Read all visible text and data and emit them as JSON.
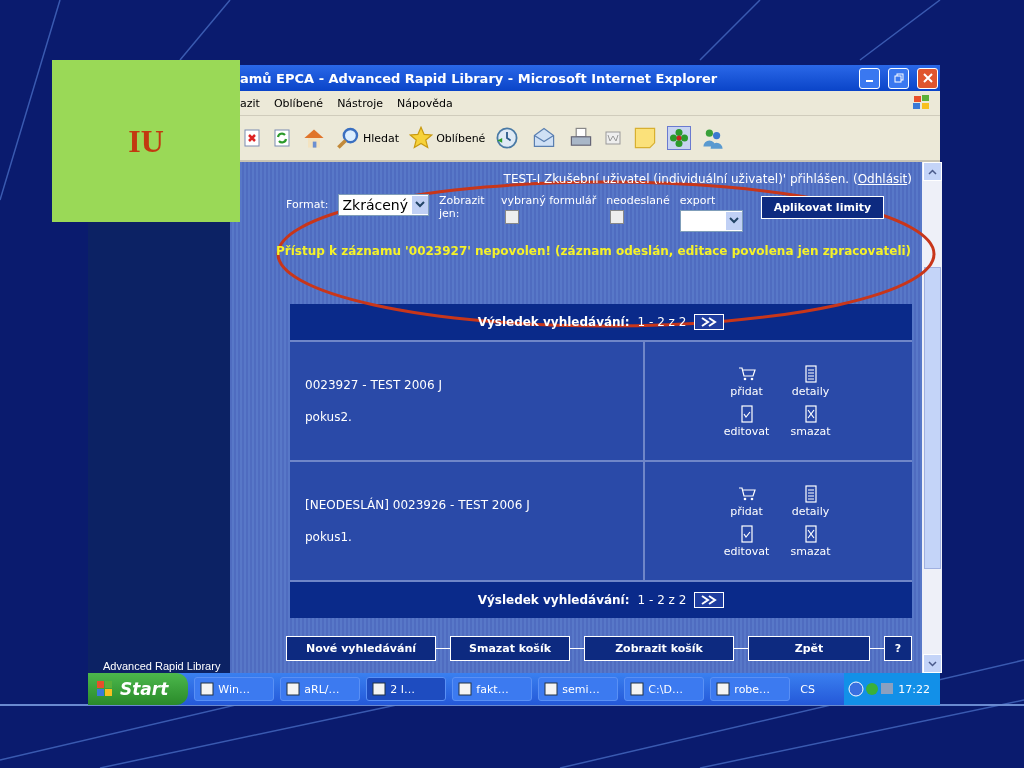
{
  "slide": {
    "label": "IU"
  },
  "window": {
    "title": "amů EPCA - Advanced Rapid Library - Microsoft Internet Explorer"
  },
  "menu": [
    "azit",
    "Oblíbené",
    "Nástroje",
    "Nápověda"
  ],
  "toolbar": [
    {
      "kind": "stop"
    },
    {
      "kind": "refresh"
    },
    {
      "kind": "home"
    },
    {
      "kind": "search",
      "label": "Hledat"
    },
    {
      "kind": "favorites",
      "label": "Oblíbené"
    },
    {
      "kind": "history"
    },
    {
      "kind": "mail"
    },
    {
      "kind": "print"
    },
    {
      "kind": "word"
    },
    {
      "kind": "note"
    },
    {
      "kind": "flower"
    },
    {
      "kind": "people"
    }
  ],
  "page": {
    "user_text": "TEST-I Zkušební uživatel (individuální uživatel)' přihlášen. (",
    "logout_link": "Odhlásit",
    "user_text_end": ")",
    "format_label": "Format:",
    "format_value": "Zkrácený",
    "show_label": "Zobrazit jen:",
    "checkboxes": [
      {
        "label": "vybraný formulář",
        "checked": false
      },
      {
        "label": "neodeslané",
        "checked": false
      }
    ],
    "export_label": "export",
    "apply_button": "Aplikovat limity",
    "error": "Přístup k záznamu '0023927' nepovolen! (záznam odeslán, editace povolena jen zpracovateli)",
    "result_bars": [
      {
        "label": "Výsledek vyhledávání:",
        "range": "1 - 2  z 2"
      },
      {
        "label": "Výsledek vyhledávání:",
        "range": "1 - 2  z 2"
      }
    ],
    "records": [
      {
        "title": "0023927 - TEST 2006 J",
        "note": "pokus2.",
        "actions": [
          "přidat",
          "detaily",
          "editovat",
          "smazat"
        ]
      },
      {
        "title": "[NEODESLÁN] 0023926 - TEST 2006 J",
        "note": "pokus1.",
        "actions": [
          "přidat",
          "detaily",
          "editovat",
          "smazat"
        ]
      }
    ],
    "buttons": [
      "Nové vyhledávání",
      "Smazat košík",
      "Zobrazit košík",
      "Zpět",
      "?"
    ],
    "sidebar_footer": "Advanced Rapid Library"
  },
  "taskbar": {
    "start": "Start",
    "tasks": [
      {
        "label": "Win…",
        "selected": false
      },
      {
        "label": "aRL/…",
        "selected": false
      },
      {
        "label": "2 I…",
        "selected": true
      },
      {
        "label": "fakt…",
        "selected": false
      },
      {
        "label": "semi…",
        "selected": false
      },
      {
        "label": "C:\\D…",
        "selected": false
      },
      {
        "label": "robe…",
        "selected": false
      }
    ],
    "lang": "CS",
    "clock": "17:22"
  }
}
